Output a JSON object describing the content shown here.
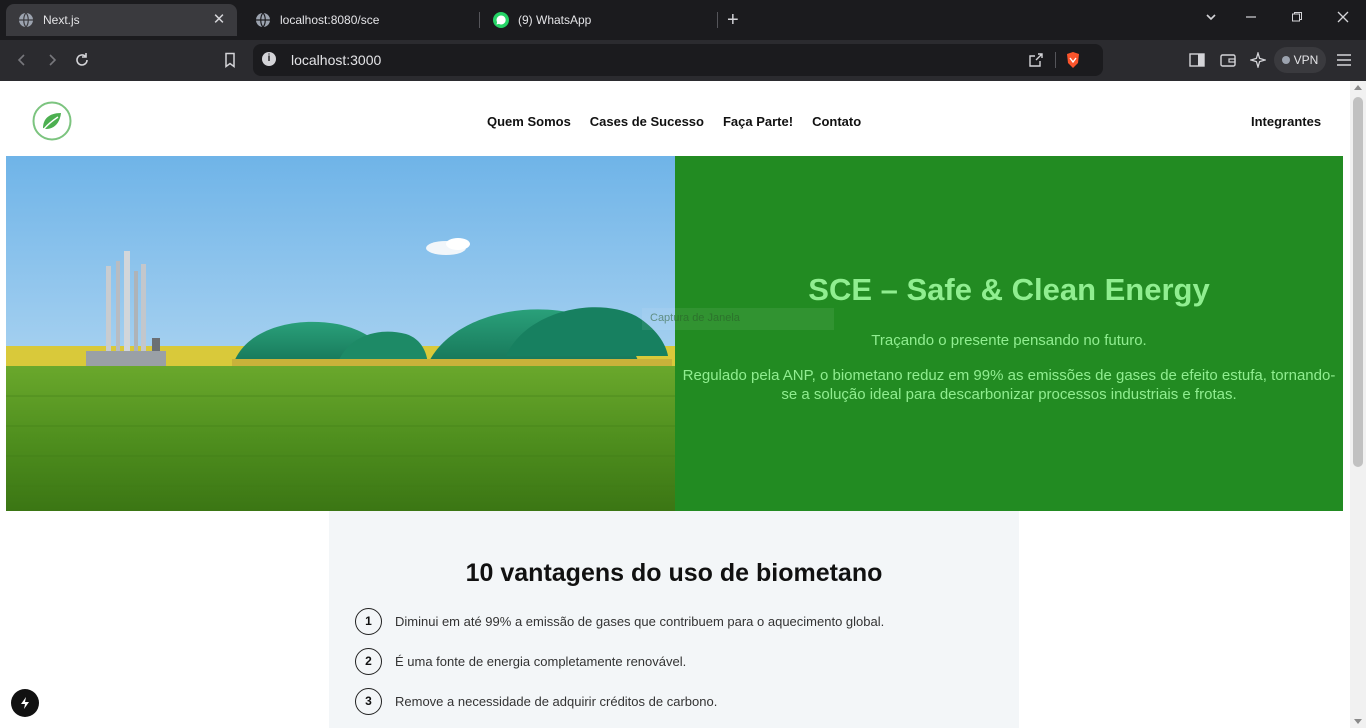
{
  "browser": {
    "tabs": [
      {
        "title": "Next.js",
        "active": true,
        "icon": "globe-icon"
      },
      {
        "title": "localhost:8080/sce",
        "active": false,
        "icon": "globe-icon"
      },
      {
        "title": "(9) WhatsApp",
        "active": false,
        "icon": "whatsapp-icon"
      }
    ],
    "url": "localhost:3000",
    "vpn_label": "VPN"
  },
  "page": {
    "nav": {
      "links": [
        "Quem Somos",
        "Cases de Sucesso",
        "Faça Parte!",
        "Contato"
      ],
      "right_link": "Integrantes"
    },
    "hero": {
      "title": "SCE – Safe & Clean Energy",
      "subtitle": "Traçando o presente pensando no futuro.",
      "description": "Regulado pela ANP, o biometano reduz em 99% as emissões de gases de efeito estufa, tornando-se a solução ideal para descarbonizar processos industriais e frotas.",
      "overlay_text": "Captura de Janela",
      "background_color": "#228b22",
      "text_color": "#90ee90"
    },
    "advantages": {
      "title": "10 vantagens do uso de biometano",
      "items": [
        {
          "num": "1",
          "text": "Diminui em até 99% a emissão de gases que contribuem para o aquecimento global."
        },
        {
          "num": "2",
          "text": "É uma fonte de energia completamente renovável."
        },
        {
          "num": "3",
          "text": "Remove a necessidade de adquirir créditos de carbono."
        }
      ]
    }
  }
}
